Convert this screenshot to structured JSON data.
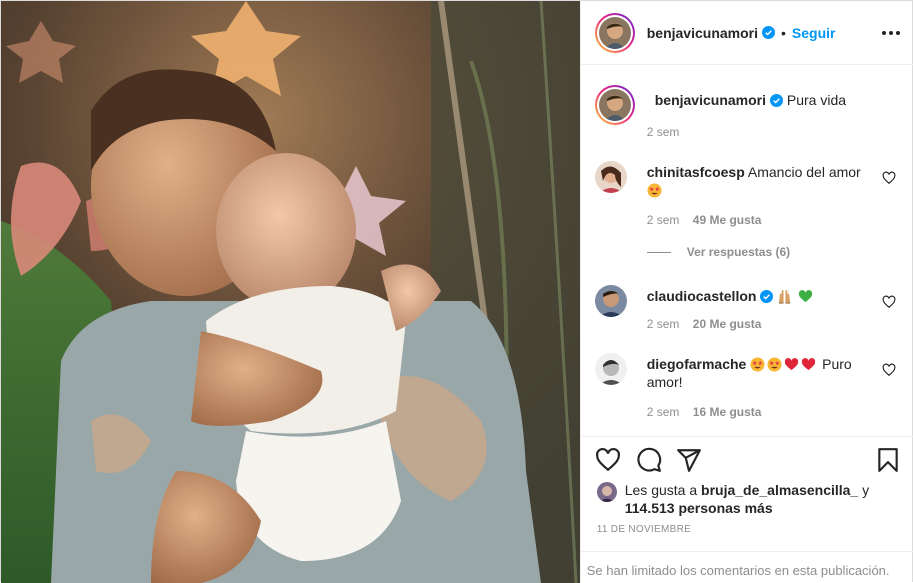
{
  "post": {
    "author": "benjavicunamori",
    "follow_label": "Seguir",
    "dot": "•",
    "caption": "Pura vida",
    "caption_time": "2 sem",
    "date": "11 DE NOVIEMBRE",
    "comments_limited": "Se han limitado los comentarios en esta publicación."
  },
  "comments": [
    {
      "user": "chinitasfcoesp",
      "text": "Amancio del amor",
      "emojis": [
        "star-struck"
      ],
      "time": "2 sem",
      "likes": "49 Me gusta",
      "replies": "Ver respuestas (6)"
    },
    {
      "user": "claudiocastellon",
      "verified": true,
      "text": "",
      "emojis": [
        "raising-hands",
        "green-heart"
      ],
      "time": "2 sem",
      "likes": "20 Me gusta"
    },
    {
      "user": "diegofarmache",
      "text": "Puro amor!",
      "emojis": [
        "star-struck",
        "star-struck",
        "red-heart",
        "red-heart"
      ],
      "time": "2 sem",
      "likes": "16 Me gusta"
    }
  ],
  "likes": {
    "prefix": "Les gusta a",
    "user": "bruja_de_almasencilla_",
    "connector": "y",
    "count": "114.513 personas más"
  },
  "colors": {
    "link": "#0095f6",
    "muted": "#8e8e8e",
    "verified": "#0095f6"
  }
}
